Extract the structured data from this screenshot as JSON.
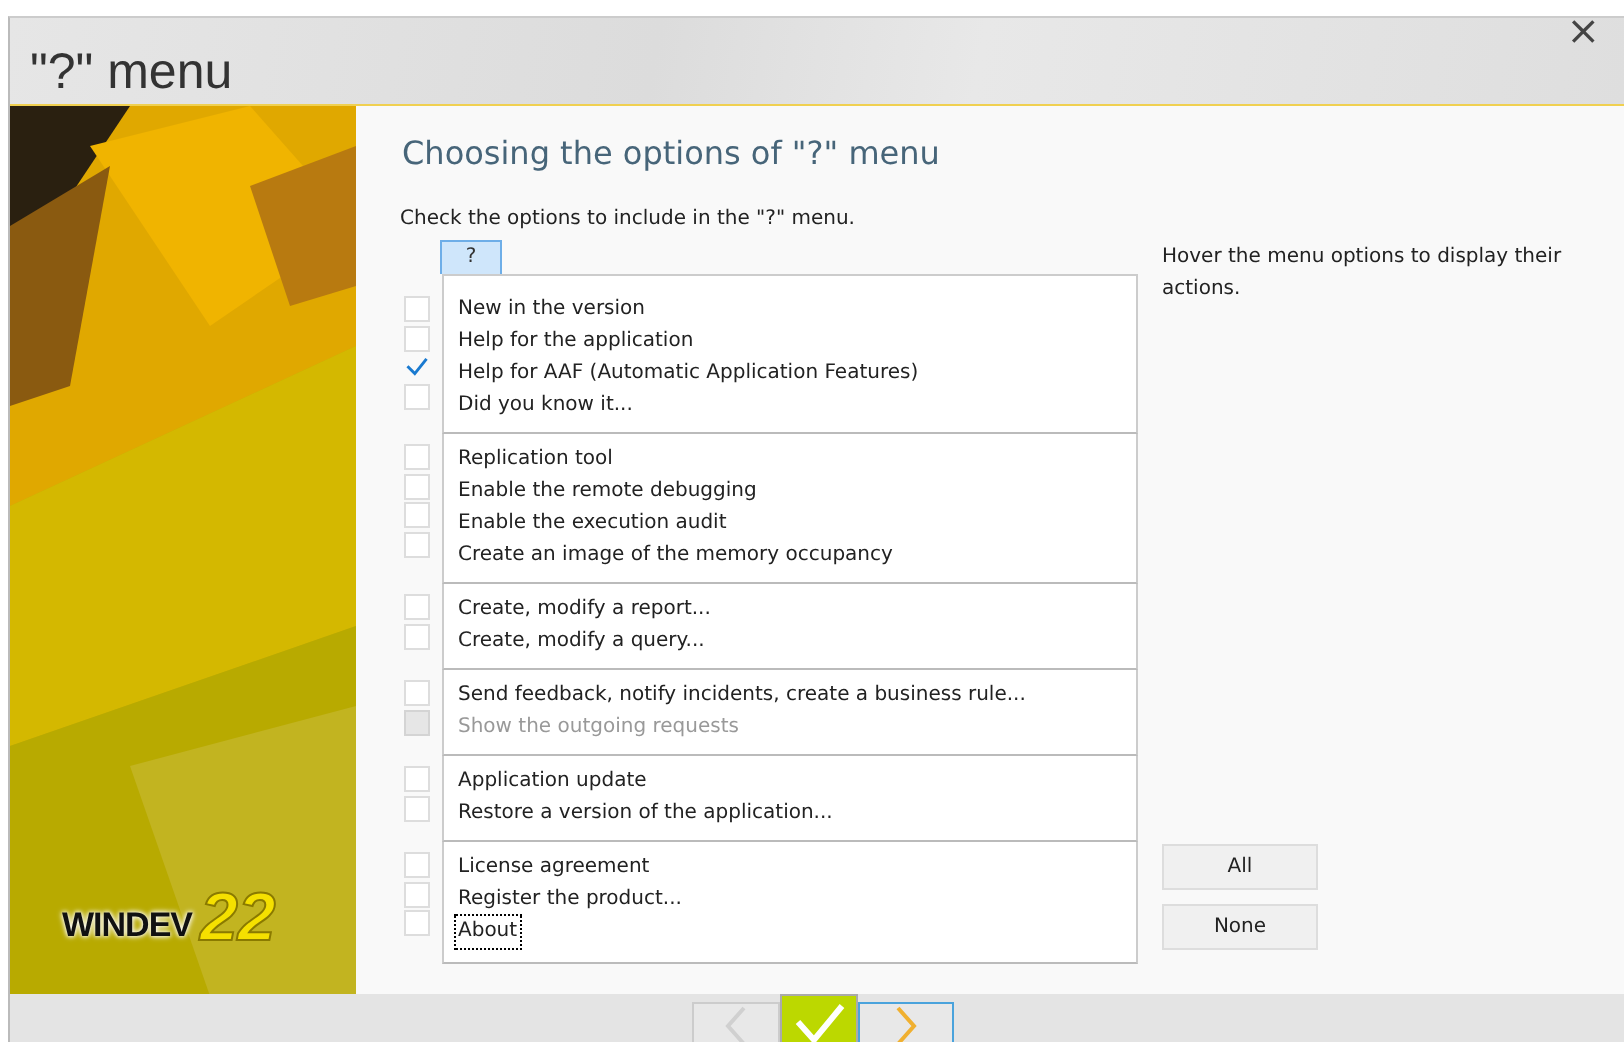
{
  "window": {
    "title": "\"?\" menu",
    "close": "×"
  },
  "logo": {
    "name": "WINDEV",
    "version": "22"
  },
  "heading": "Choosing the options of \"?\" menu",
  "instruction": "Check the options to include in the \"?\" menu.",
  "menu_tab": "?",
  "option_groups": [
    {
      "items": [
        {
          "label": "New in the version",
          "checked": false,
          "disabled": false,
          "focused": false
        },
        {
          "label": "Help for the application",
          "checked": false,
          "disabled": false,
          "focused": false
        },
        {
          "label": "Help for AAF (Automatic Application Features)",
          "checked": true,
          "disabled": false,
          "focused": false
        },
        {
          "label": "Did you know it...",
          "checked": false,
          "disabled": false,
          "focused": false
        }
      ]
    },
    {
      "items": [
        {
          "label": "Replication tool",
          "checked": false,
          "disabled": false,
          "focused": false
        },
        {
          "label": "Enable the remote debugging",
          "checked": false,
          "disabled": false,
          "focused": false
        },
        {
          "label": "Enable the execution audit",
          "checked": false,
          "disabled": false,
          "focused": false
        },
        {
          "label": "Create an image of the memory occupancy",
          "checked": false,
          "disabled": false,
          "focused": false
        }
      ]
    },
    {
      "items": [
        {
          "label": "Create, modify a report...",
          "checked": false,
          "disabled": false,
          "focused": false
        },
        {
          "label": "Create, modify a query...",
          "checked": false,
          "disabled": false,
          "focused": false
        }
      ]
    },
    {
      "items": [
        {
          "label": "Send feedback, notify incidents, create a business rule...",
          "checked": false,
          "disabled": false,
          "focused": false
        },
        {
          "label": "Show the outgoing requests",
          "checked": false,
          "disabled": true,
          "focused": false
        }
      ]
    },
    {
      "items": [
        {
          "label": "Application update",
          "checked": false,
          "disabled": false,
          "focused": false
        },
        {
          "label": "Restore a version of the application...",
          "checked": false,
          "disabled": false,
          "focused": false
        }
      ]
    },
    {
      "items": [
        {
          "label": "License agreement",
          "checked": false,
          "disabled": false,
          "focused": false
        },
        {
          "label": "Register the product...",
          "checked": false,
          "disabled": false,
          "focused": false
        },
        {
          "label": "About",
          "checked": false,
          "disabled": false,
          "focused": true
        }
      ]
    }
  ],
  "hint": "Hover the menu options to display their actions.",
  "side_buttons": [
    "All",
    "None"
  ],
  "nav": {
    "back_disabled": true
  }
}
